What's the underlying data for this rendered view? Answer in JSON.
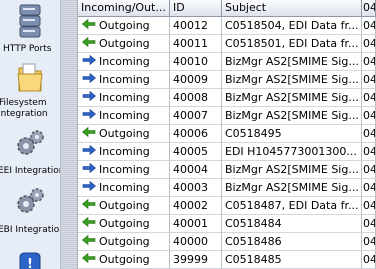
{
  "sidebar": {
    "items": [
      {
        "label": "HTTP Ports",
        "icon": "server-icon"
      },
      {
        "label": "Filesystem\nIntegration",
        "icon": "folder-icon"
      },
      {
        "label": "EEI Integration",
        "icon": "gears-icon"
      },
      {
        "label": "EBI Integration",
        "icon": "gears-icon"
      },
      {
        "label": "",
        "icon": "info-icon"
      }
    ]
  },
  "table": {
    "columns": [
      "Incoming/Out...",
      "ID",
      "Subject",
      "04"
    ],
    "rows": [
      {
        "direction": "Outgoing",
        "id": "40012",
        "subject": "C0518504, EDI Data fr...",
        "date": "04"
      },
      {
        "direction": "Outgoing",
        "id": "40011",
        "subject": "C0518501, EDI Data fr...",
        "date": "04"
      },
      {
        "direction": "Incoming",
        "id": "40010",
        "subject": "BizMgr AS2[SMIME Sig...",
        "date": "04"
      },
      {
        "direction": "Incoming",
        "id": "40009",
        "subject": "BizMgr AS2[SMIME Sig...",
        "date": "04"
      },
      {
        "direction": "Incoming",
        "id": "40008",
        "subject": "BizMgr AS2[SMIME Sig...",
        "date": "04"
      },
      {
        "direction": "Incoming",
        "id": "40007",
        "subject": "BizMgr AS2[SMIME Sig...",
        "date": "04"
      },
      {
        "direction": "Outgoing",
        "id": "40006",
        "subject": "C0518495",
        "date": "04"
      },
      {
        "direction": "Incoming",
        "id": "40005",
        "subject": "EDI H1045773001300...",
        "date": "04"
      },
      {
        "direction": "Incoming",
        "id": "40004",
        "subject": "BizMgr AS2[SMIME Sig...",
        "date": "04"
      },
      {
        "direction": "Incoming",
        "id": "40003",
        "subject": "BizMgr AS2[SMIME Sig...",
        "date": "04"
      },
      {
        "direction": "Outgoing",
        "id": "40002",
        "subject": "C0518487, EDI Data fr...",
        "date": "04"
      },
      {
        "direction": "Outgoing",
        "id": "40001",
        "subject": "C0518484",
        "date": "04"
      },
      {
        "direction": "Outgoing",
        "id": "40000",
        "subject": "C0518486",
        "date": "04"
      },
      {
        "direction": "Outgoing",
        "id": "39999",
        "subject": "C0518485",
        "date": "04"
      }
    ]
  },
  "colors": {
    "outgoing_arrow": "#3aa020",
    "incoming_arrow": "#2a62c8",
    "sidebar_bg": "#e6edf6"
  }
}
